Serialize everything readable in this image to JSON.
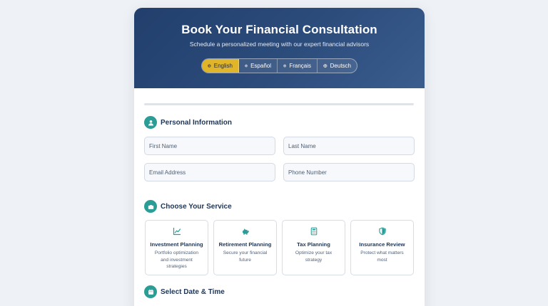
{
  "header": {
    "title": "Book Your Financial Consultation",
    "subtitle": "Schedule a personalized meeting with our expert financial advisors"
  },
  "languages": [
    {
      "label": "English",
      "active": true
    },
    {
      "label": "Español",
      "active": false
    },
    {
      "label": "Français",
      "active": false
    },
    {
      "label": "Deutsch",
      "active": false
    }
  ],
  "personal": {
    "heading": "Personal Information",
    "first_name_placeholder": "First Name",
    "last_name_placeholder": "Last Name",
    "email_placeholder": "Email Address",
    "phone_placeholder": "Phone Number"
  },
  "service": {
    "heading": "Choose Your Service",
    "options": [
      {
        "name": "Investment Planning",
        "desc": "Portfolio optimization and investment strategies",
        "icon": "chart-line-icon"
      },
      {
        "name": "Retirement Planning",
        "desc": "Secure your financial future",
        "icon": "piggy-bank-icon"
      },
      {
        "name": "Tax Planning",
        "desc": "Optimize your tax strategy",
        "icon": "calculator-icon"
      },
      {
        "name": "Insurance Review",
        "desc": "Protect what matters most",
        "icon": "shield-icon"
      }
    ]
  },
  "datetime": {
    "heading": "Select Date & Time"
  },
  "colors": {
    "header_bg": "#2c4c7c",
    "accent_teal": "#2a9d96",
    "active_lang": "#e0b52a"
  }
}
